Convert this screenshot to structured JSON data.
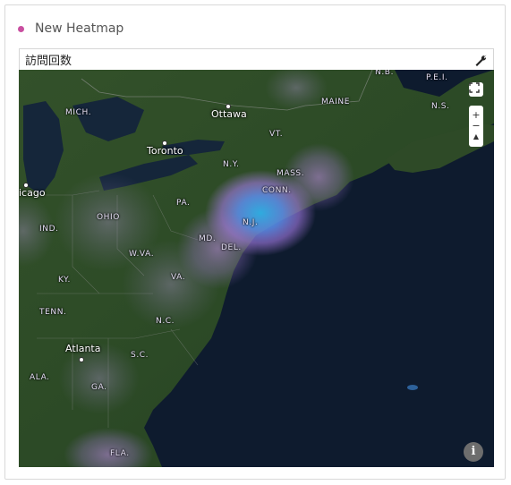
{
  "widget": {
    "title": "New Heatmap",
    "accent_color": "#c94fa0"
  },
  "toolbar": {
    "metric_label": "訪問回数",
    "settings_icon": "wrench-icon"
  },
  "map": {
    "controls": {
      "fullscreen_icon": "fullscreen-icon",
      "zoom_in": "+",
      "zoom_out": "−",
      "compass": "▲"
    },
    "info_icon": "i",
    "region_labels": {
      "nb": "N.B.",
      "pei": "P.E.I.",
      "ns": "N.S.",
      "maine": "MAINE",
      "mich": "MICH.",
      "vt": "VT.",
      "ny": "N.Y.",
      "mass": "MASS.",
      "conn": "CONN.",
      "nj": "N.J.",
      "pa": "PA.",
      "ohio": "OHIO",
      "ind": "IND.",
      "md": "MD.",
      "del": "DEL.",
      "wva": "W.VA.",
      "va": "VA.",
      "ky": "KY.",
      "tenn": "TENN.",
      "nc": "N.C.",
      "sc": "S.C.",
      "ala": "ALA.",
      "ga": "GA.",
      "fla": "FLA."
    },
    "cities": {
      "ottawa": "Ottawa",
      "toronto": "Toronto",
      "chicago": "icago",
      "atlanta": "Atlanta"
    },
    "heat_colors": {
      "low": "#b08be0",
      "mid": "#9c7cf0",
      "high": "#3fa9e6"
    }
  }
}
